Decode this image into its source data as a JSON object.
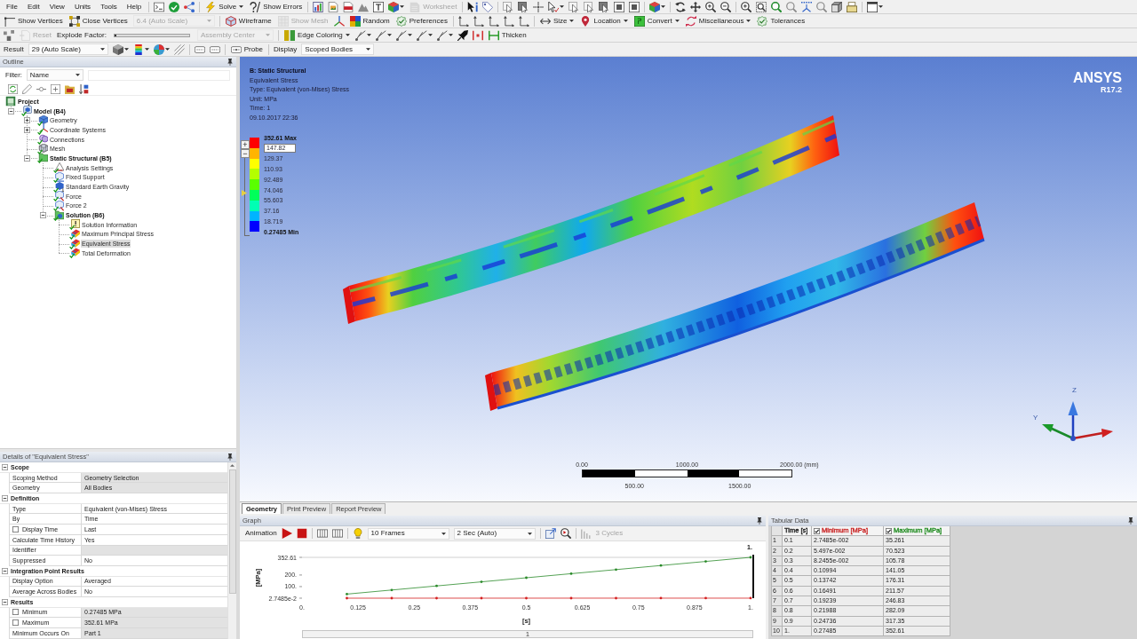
{
  "menu": [
    {
      "label": "File"
    },
    {
      "label": "Edit"
    },
    {
      "label": "View"
    },
    {
      "label": "Units"
    },
    {
      "label": "Tools"
    },
    {
      "label": "Help"
    }
  ],
  "toolbars": [
    [
      {
        "kind": "button",
        "label": "Solve",
        "disabled": false,
        "dropdown": true
      },
      {
        "kind": "button",
        "label": "Show Errors",
        "disabled": false,
        "dropdown": false
      },
      {
        "kind": "button",
        "label": "Worksheet",
        "disabled": true,
        "dropdown": false
      }
    ],
    [
      {
        "kind": "button",
        "label": "Show Vertices",
        "disabled": false,
        "dropdown": false
      },
      {
        "kind": "button",
        "label": "Close Vertices",
        "disabled": false,
        "dropdown": false
      },
      {
        "kind": "dropdown",
        "value": "6.4 (Auto Scale)",
        "disabled": true
      },
      {
        "kind": "button",
        "label": "Wireframe",
        "disabled": false,
        "dropdown": false
      },
      {
        "kind": "button",
        "label": "Show Mesh",
        "disabled": true,
        "dropdown": false
      },
      {
        "kind": "button",
        "label": "Random",
        "disabled": false,
        "dropdown": false
      },
      {
        "kind": "button",
        "label": "Preferences",
        "disabled": false,
        "dropdown": false
      },
      {
        "kind": "button",
        "label": "Size",
        "disabled": false,
        "dropdown": true
      },
      {
        "kind": "button",
        "label": "Location",
        "disabled": false,
        "dropdown": true
      },
      {
        "kind": "button",
        "label": "Convert",
        "disabled": false,
        "dropdown": true
      },
      {
        "kind": "button",
        "label": "Miscellaneous",
        "disabled": false,
        "dropdown": true
      },
      {
        "kind": "button",
        "label": "Tolerances",
        "disabled": false,
        "dropdown": false
      }
    ],
    [
      {
        "kind": "button",
        "label": "Reset",
        "disabled": true,
        "dropdown": false
      },
      {
        "kind": "label",
        "label": "Explode Factor:"
      },
      {
        "kind": "slider",
        "level": 0
      },
      {
        "kind": "dropdown",
        "value": "Assembly Center",
        "disabled": true
      },
      {
        "kind": "button",
        "label": "Edge Coloring",
        "disabled": false,
        "dropdown": true
      },
      {
        "kind": "button",
        "label": "Thicken",
        "disabled": false,
        "dropdown": false
      }
    ],
    [
      {
        "kind": "label",
        "label": "Result"
      },
      {
        "kind": "dropdown",
        "value": "29 (Auto Scale)",
        "disabled": false
      },
      {
        "kind": "button",
        "label": "Probe",
        "disabled": false,
        "dropdown": false
      },
      {
        "kind": "label",
        "label": "Display"
      },
      {
        "kind": "dropdown",
        "value": "Scoped Bodies",
        "disabled": false
      }
    ]
  ],
  "outline": {
    "title": "Outline",
    "filter": {
      "label": "Filter:",
      "dropdown": "Name"
    },
    "tree": [
      {
        "label": "Project",
        "kind": "project",
        "selected": false,
        "children": [
          {
            "label": "Model (B4)",
            "kind": "model",
            "expanded": true,
            "selected": false,
            "children": [
              {
                "label": "Geometry",
                "kind": "geometry",
                "expanded": false,
                "selected": false
              },
              {
                "label": "Coordinate Systems",
                "kind": "coordinates",
                "expanded": false,
                "selected": false
              },
              {
                "label": "Connections",
                "kind": "connections",
                "selected": false
              },
              {
                "label": "Mesh",
                "kind": "mesh",
                "selected": false
              },
              {
                "label": "Static Structural (B5)",
                "kind": "analysis",
                "expanded": true,
                "selected": false,
                "children": [
                  {
                    "label": "Analysis Settings",
                    "kind": "settings",
                    "selected": false
                  },
                  {
                    "label": "Fixed Support",
                    "kind": "support",
                    "selected": false
                  },
                  {
                    "label": "Standard Earth Gravity",
                    "kind": "gravity",
                    "selected": false
                  },
                  {
                    "label": "Force",
                    "kind": "force",
                    "selected": false
                  },
                  {
                    "label": "Force 2",
                    "kind": "force",
                    "selected": false
                  },
                  {
                    "label": "Solution (B6)",
                    "kind": "solution",
                    "expanded": true,
                    "selected": false,
                    "children": [
                      {
                        "label": "Solution Information",
                        "kind": "info",
                        "selected": false
                      },
                      {
                        "label": "Maximum Principal Stress",
                        "kind": "result",
                        "selected": false
                      },
                      {
                        "label": "Equivalent Stress",
                        "kind": "result",
                        "selected": true
                      },
                      {
                        "label": "Total Deformation",
                        "kind": "result",
                        "selected": false
                      }
                    ]
                  }
                ]
              }
            ]
          }
        ]
      }
    ]
  },
  "details": {
    "title": "Details of \"Equivalent Stress\"",
    "sections": [
      {
        "title": "Scope",
        "expanded": true,
        "rows": [
          {
            "label": "Scoping Method",
            "value": "Geometry Selection",
            "readonly": true
          },
          {
            "label": "Geometry",
            "value": "All Bodies",
            "readonly": true
          }
        ]
      },
      {
        "title": "Definition",
        "expanded": true,
        "rows": [
          {
            "label": "Type",
            "value": "Equivalent (von-Mises) Stress",
            "readonly": false
          },
          {
            "label": "By",
            "value": "Time",
            "readonly": false
          },
          {
            "label": "Display Time",
            "value": "Last",
            "readonly": false,
            "checked": false
          },
          {
            "label": "Calculate Time History",
            "value": "Yes",
            "readonly": false
          },
          {
            "label": "Identifier",
            "readonly": true
          },
          {
            "label": "Suppressed",
            "value": "No",
            "readonly": false
          }
        ]
      },
      {
        "title": "Integration Point Results",
        "expanded": true,
        "rows": [
          {
            "label": "Display Option",
            "value": "Averaged",
            "readonly": false
          },
          {
            "label": "Average Across Bodies",
            "value": "No",
            "readonly": false
          }
        ]
      },
      {
        "title": "Results",
        "expanded": true,
        "rows": [
          {
            "label": "Minimum",
            "value": "0.27485 MPa",
            "readonly": true,
            "checked": false
          },
          {
            "label": "Maximum",
            "value": "352.61 MPa",
            "readonly": true,
            "checked": false
          },
          {
            "label": "Minimum Occurs On",
            "value": "Part 1",
            "readonly": true
          }
        ]
      }
    ]
  },
  "viewport": {
    "header": [
      {
        "kind": "title",
        "text": "B: Static Structural"
      },
      {
        "kind": "line",
        "text": "Equivalent Stress"
      },
      {
        "kind": "line",
        "text": "Type: Equivalent (von-Mises) Stress"
      },
      {
        "kind": "line",
        "text": "Unit: MPa"
      },
      {
        "kind": "line",
        "text": "Time: 1"
      },
      {
        "kind": "line",
        "text": "09.10.2017 22:36"
      }
    ],
    "legend": {
      "buttons": [
        "+",
        "−"
      ],
      "bands": [
        {
          "color": "#ff0000"
        },
        {
          "color": "#ffb400"
        },
        {
          "color": "#ffff00"
        },
        {
          "color": "#b4ff00"
        },
        {
          "color": "#5aff00"
        },
        {
          "color": "#00ff5a"
        },
        {
          "color": "#00ffb4"
        },
        {
          "color": "#00b4ff"
        },
        {
          "color": "#0000ff"
        }
      ],
      "labels": [
        {
          "kind": "max",
          "text": "352.61 Max"
        },
        {
          "kind": "edit",
          "text": "147.82"
        },
        {
          "kind": "value",
          "text": "129.37"
        },
        {
          "kind": "value",
          "text": "110.93"
        },
        {
          "kind": "value",
          "text": "92.489"
        },
        {
          "kind": "value",
          "text": "74.046"
        },
        {
          "kind": "value",
          "text": "55.603"
        },
        {
          "kind": "value",
          "text": "37.16"
        },
        {
          "kind": "value",
          "text": "18.719"
        },
        {
          "kind": "min",
          "text": "0.27485 Min"
        }
      ]
    },
    "logo": {
      "name": "ANSYS",
      "release": "R17.2"
    },
    "scale_bar": {
      "top_labels": [
        "0.00",
        "1000.00",
        "2000.00 (mm)"
      ],
      "bottom_labels": [
        "500.00",
        "1500.00"
      ]
    },
    "triad": {
      "labels": [
        "Z",
        "Y"
      ]
    }
  },
  "tabs": [
    {
      "label": "Geometry",
      "selected": true
    },
    {
      "label": "Print Preview",
      "selected": false
    },
    {
      "label": "Report Preview",
      "selected": false
    }
  ],
  "graph": {
    "title": "Graph",
    "toolbar": [
      {
        "kind": "label",
        "label": "Animation",
        "disabled": false
      },
      {
        "kind": "dropdown",
        "value": "10 Frames",
        "disabled": false
      },
      {
        "kind": "dropdown",
        "value": "2 Sec (Auto)",
        "disabled": false
      },
      {
        "kind": "label",
        "label": "3 Cycles",
        "disabled": true
      }
    ],
    "chart_data": {
      "type": "line",
      "xlabel": "[s]",
      "ylabel": "[MPa]",
      "x": [
        0.1,
        0.2,
        0.3,
        0.4,
        0.5,
        0.6,
        0.7,
        0.8,
        0.9,
        1
      ],
      "xlim": [
        0,
        1
      ],
      "ylim": [
        0.027485,
        352.61
      ],
      "xticks": [
        {
          "value": 0,
          "label": "0."
        },
        {
          "value": 0.125,
          "label": "0.125"
        },
        {
          "value": 0.25,
          "label": "0.25"
        },
        {
          "value": 0.375,
          "label": "0.375"
        },
        {
          "value": 0.5,
          "label": "0.5"
        },
        {
          "value": 0.625,
          "label": "0.625"
        },
        {
          "value": 0.75,
          "label": "0.75"
        },
        {
          "value": 0.875,
          "label": "0.875"
        },
        {
          "value": 1,
          "label": "1."
        }
      ],
      "yticks": [
        {
          "value": 0.027485,
          "label": "2.7485e-2"
        },
        {
          "value": 100,
          "label": "100."
        },
        {
          "value": 200,
          "label": "200."
        },
        {
          "value": 352.61,
          "label": "352.61"
        }
      ],
      "series": [
        {
          "color": "#d42020",
          "values": [
            0.027485,
            0.05497,
            0.082455,
            0.10994,
            0.13742,
            0.16491,
            0.19239,
            0.21988,
            0.24736,
            0.27485
          ]
        },
        {
          "color": "#2a8a2a",
          "values": [
            35.261,
            70.523,
            105.78,
            141.05,
            176.31,
            211.57,
            246.83,
            282.09,
            317.35,
            352.61
          ]
        }
      ]
    },
    "marker": {
      "label": "1."
    },
    "timeline": {
      "label": "1"
    }
  },
  "tabular": {
    "title": "Tabular Data",
    "columns": [
      {
        "label": "Time [s]"
      },
      {
        "label": "Minimum [MPa]",
        "checked": true,
        "color": "#c81e1e"
      },
      {
        "label": "Maximum [MPa]",
        "checked": true,
        "color": "#1e8a1e"
      }
    ],
    "rows": [
      {
        "index": "1",
        "cells": [
          "0.1",
          "2.7485e-002",
          "35.261"
        ]
      },
      {
        "index": "2",
        "cells": [
          "0.2",
          "5.497e-002",
          "70.523"
        ]
      },
      {
        "index": "3",
        "cells": [
          "0.3",
          "8.2455e-002",
          "105.78"
        ]
      },
      {
        "index": "4",
        "cells": [
          "0.4",
          "0.10994",
          "141.05"
        ]
      },
      {
        "index": "5",
        "cells": [
          "0.5",
          "0.13742",
          "176.31"
        ]
      },
      {
        "index": "6",
        "cells": [
          "0.6",
          "0.16491",
          "211.57"
        ]
      },
      {
        "index": "7",
        "cells": [
          "0.7",
          "0.19239",
          "246.83"
        ]
      },
      {
        "index": "8",
        "cells": [
          "0.8",
          "0.21988",
          "282.09"
        ]
      },
      {
        "index": "9",
        "cells": [
          "0.9",
          "0.24736",
          "317.35"
        ]
      },
      {
        "index": "10",
        "cells": [
          "1.",
          "0.27485",
          "352.61"
        ]
      }
    ]
  }
}
